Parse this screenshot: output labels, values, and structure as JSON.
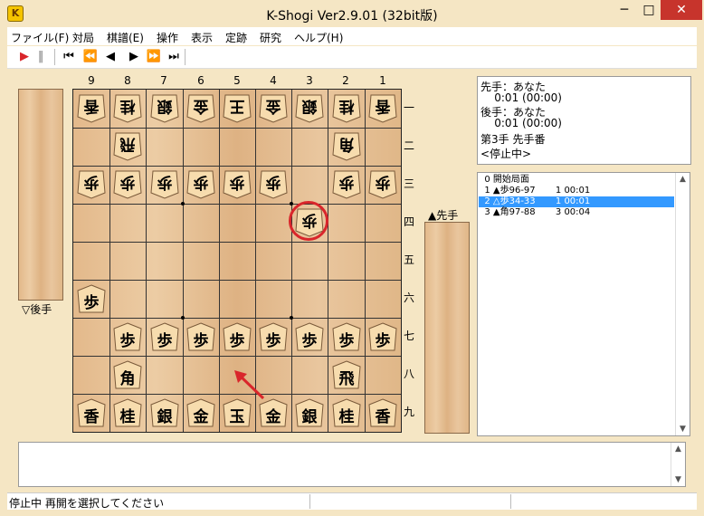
{
  "window": {
    "title": "K-Shogi Ver2.9.01 (32bit版)",
    "app_icon_letter": "K",
    "buttons": {
      "minimize": "─",
      "maximize": "□",
      "close": "✕"
    }
  },
  "menu": [
    {
      "id": "file",
      "label": "ファイル(F)"
    },
    {
      "id": "taikyoku",
      "label": "対局"
    },
    {
      "id": "kifu",
      "label": "棋譜(E)"
    },
    {
      "id": "sousa",
      "label": "操作"
    },
    {
      "id": "hyouji",
      "label": "表示"
    },
    {
      "id": "joseki",
      "label": "定跡"
    },
    {
      "id": "kenkyu",
      "label": "研究"
    },
    {
      "id": "help",
      "label": "ヘルプ(H)"
    }
  ],
  "toolbar": {
    "play_icon": "play-icon",
    "pause_icon": "pause-icon",
    "first_icon": "first-move-icon",
    "back_fast_icon": "fast-back-icon",
    "back_icon": "step-back-icon",
    "forward_icon": "step-forward-icon",
    "forward_fast_icon": "fast-forward-icon",
    "last_icon": "last-move-icon",
    "play_color": "#d9262b"
  },
  "board": {
    "files": [
      "9",
      "8",
      "7",
      "6",
      "5",
      "4",
      "3",
      "2",
      "1"
    ],
    "ranks": [
      "一",
      "二",
      "三",
      "四",
      "五",
      "六",
      "七",
      "八",
      "九"
    ],
    "pieces": [
      {
        "file": 9,
        "rank": 1,
        "char": "香",
        "side": "gote"
      },
      {
        "file": 8,
        "rank": 1,
        "char": "桂",
        "side": "gote"
      },
      {
        "file": 7,
        "rank": 1,
        "char": "銀",
        "side": "gote"
      },
      {
        "file": 6,
        "rank": 1,
        "char": "金",
        "side": "gote"
      },
      {
        "file": 5,
        "rank": 1,
        "char": "王",
        "side": "gote"
      },
      {
        "file": 4,
        "rank": 1,
        "char": "金",
        "side": "gote"
      },
      {
        "file": 3,
        "rank": 1,
        "char": "銀",
        "side": "gote"
      },
      {
        "file": 2,
        "rank": 1,
        "char": "桂",
        "side": "gote"
      },
      {
        "file": 1,
        "rank": 1,
        "char": "香",
        "side": "gote"
      },
      {
        "file": 8,
        "rank": 2,
        "char": "飛",
        "side": "gote"
      },
      {
        "file": 2,
        "rank": 2,
        "char": "角",
        "side": "gote"
      },
      {
        "file": 9,
        "rank": 3,
        "char": "歩",
        "side": "gote"
      },
      {
        "file": 8,
        "rank": 3,
        "char": "歩",
        "side": "gote"
      },
      {
        "file": 7,
        "rank": 3,
        "char": "歩",
        "side": "gote"
      },
      {
        "file": 6,
        "rank": 3,
        "char": "歩",
        "side": "gote"
      },
      {
        "file": 5,
        "rank": 3,
        "char": "歩",
        "side": "gote"
      },
      {
        "file": 4,
        "rank": 3,
        "char": "歩",
        "side": "gote"
      },
      {
        "file": 2,
        "rank": 3,
        "char": "歩",
        "side": "gote"
      },
      {
        "file": 1,
        "rank": 3,
        "char": "歩",
        "side": "gote"
      },
      {
        "file": 3,
        "rank": 4,
        "char": "歩",
        "side": "gote"
      },
      {
        "file": 9,
        "rank": 6,
        "char": "歩",
        "side": "sente"
      },
      {
        "file": 8,
        "rank": 7,
        "char": "歩",
        "side": "sente"
      },
      {
        "file": 7,
        "rank": 7,
        "char": "歩",
        "side": "sente"
      },
      {
        "file": 6,
        "rank": 7,
        "char": "歩",
        "side": "sente"
      },
      {
        "file": 5,
        "rank": 7,
        "char": "歩",
        "side": "sente"
      },
      {
        "file": 4,
        "rank": 7,
        "char": "歩",
        "side": "sente"
      },
      {
        "file": 3,
        "rank": 7,
        "char": "歩",
        "side": "sente"
      },
      {
        "file": 2,
        "rank": 7,
        "char": "歩",
        "side": "sente"
      },
      {
        "file": 1,
        "rank": 7,
        "char": "歩",
        "side": "sente"
      },
      {
        "file": 8,
        "rank": 8,
        "char": "角",
        "side": "sente"
      },
      {
        "file": 2,
        "rank": 8,
        "char": "飛",
        "side": "sente"
      },
      {
        "file": 9,
        "rank": 9,
        "char": "香",
        "side": "sente"
      },
      {
        "file": 8,
        "rank": 9,
        "char": "桂",
        "side": "sente"
      },
      {
        "file": 7,
        "rank": 9,
        "char": "銀",
        "side": "sente"
      },
      {
        "file": 6,
        "rank": 9,
        "char": "金",
        "side": "sente"
      },
      {
        "file": 5,
        "rank": 9,
        "char": "玉",
        "side": "sente"
      },
      {
        "file": 4,
        "rank": 9,
        "char": "金",
        "side": "sente"
      },
      {
        "file": 3,
        "rank": 9,
        "char": "銀",
        "side": "sente"
      },
      {
        "file": 2,
        "rank": 9,
        "char": "桂",
        "side": "sente"
      },
      {
        "file": 1,
        "rank": 9,
        "char": "香",
        "side": "sente"
      }
    ],
    "last_move_highlight_color": "#d9262b",
    "arrow_color": "#d9262b"
  },
  "stands": {
    "gote_label": "▽後手",
    "sente_label": "▲先手"
  },
  "info": {
    "line1": "先手：あなた",
    "line2": "    0:01 (00:00)",
    "line3": "後手：あなた",
    "line4": "    0:01 (00:00)",
    "line5": "第3手 先手番",
    "line6": "<停止中>"
  },
  "moves": [
    {
      "text": "  0 開始局面",
      "selected": false
    },
    {
      "text": "  1 ▲歩96-97       1 00:01",
      "selected": false
    },
    {
      "text": "  2 △歩34-33       1 00:01",
      "selected": true
    },
    {
      "text": "  3 ▲角97-88       3 00:04",
      "selected": false
    }
  ],
  "scroll": {
    "up": "▲",
    "down": "▼"
  },
  "status": {
    "text": "停止中 再開を選択してください"
  },
  "colors": {
    "selection": "#3399ff",
    "close_button": "#c7342c",
    "background": "#f5e6c4"
  }
}
